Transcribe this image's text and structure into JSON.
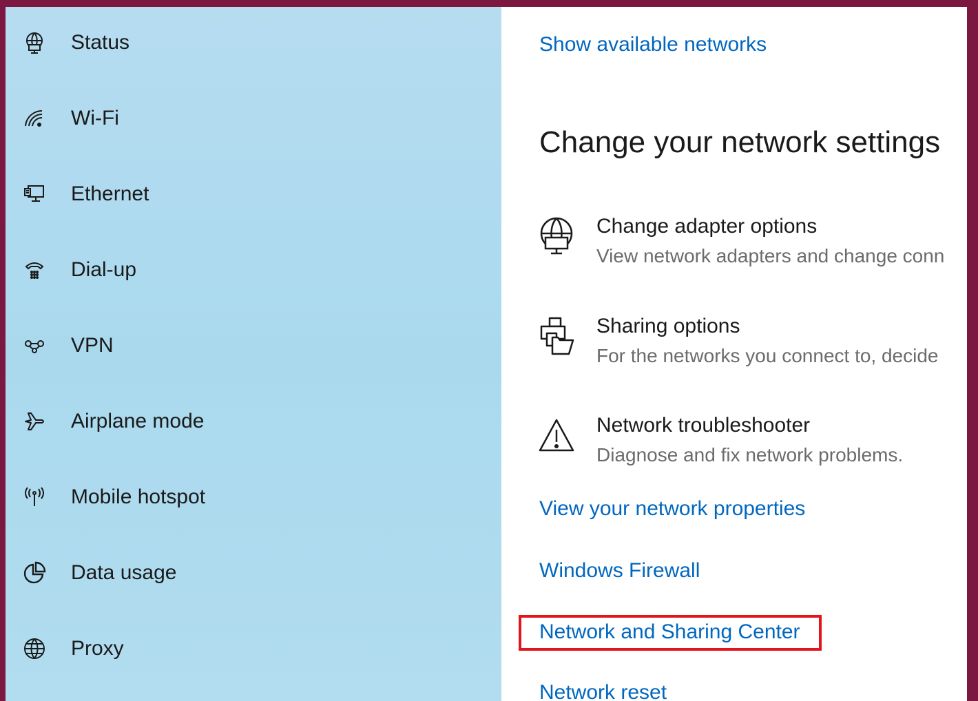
{
  "sidebar": {
    "items": [
      {
        "label": "Status",
        "icon": "globe-monitor-icon"
      },
      {
        "label": "Wi-Fi",
        "icon": "wifi-icon"
      },
      {
        "label": "Ethernet",
        "icon": "ethernet-icon"
      },
      {
        "label": "Dial-up",
        "icon": "dialup-icon"
      },
      {
        "label": "VPN",
        "icon": "vpn-icon"
      },
      {
        "label": "Airplane mode",
        "icon": "airplane-icon"
      },
      {
        "label": "Mobile hotspot",
        "icon": "hotspot-icon"
      },
      {
        "label": "Data usage",
        "icon": "data-usage-icon"
      },
      {
        "label": "Proxy",
        "icon": "globe-icon"
      }
    ]
  },
  "main": {
    "show_networks_link": "Show available networks",
    "section_title": "Change your network settings",
    "options": [
      {
        "title": "Change adapter options",
        "desc": "View network adapters and change conn",
        "icon": "adapter-icon"
      },
      {
        "title": "Sharing options",
        "desc": "For the networks you connect to, decide",
        "icon": "sharing-icon"
      },
      {
        "title": "Network troubleshooter",
        "desc": "Diagnose and fix network problems.",
        "icon": "warning-icon"
      }
    ],
    "links": {
      "properties": "View your network properties",
      "firewall": "Windows Firewall",
      "sharing_center": "Network and Sharing Center",
      "reset": "Network reset"
    }
  },
  "colors": {
    "frame": "#7b1741",
    "link": "#0067c0",
    "highlight": "#e4141d",
    "sidebar_bg": "#aad9ee"
  }
}
